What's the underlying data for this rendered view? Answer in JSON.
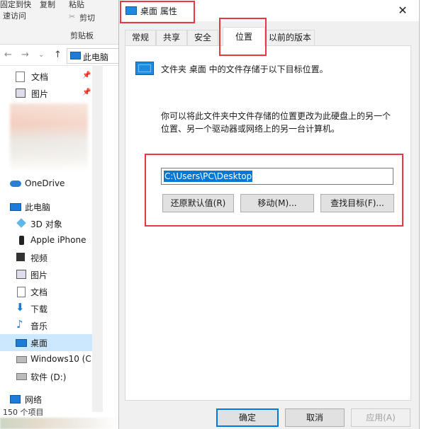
{
  "explorer": {
    "ribbon": {
      "pin_quick_access": "固定到快",
      "quick_access": "速访问",
      "copy": "复制",
      "paste": "粘贴",
      "cut": "剪切",
      "clipboard": "剪贴板"
    },
    "address": {
      "path": "此电脑"
    },
    "nav": {
      "documents": "文档",
      "pictures_pinned": "图片",
      "onedrive": "OneDrive",
      "this_pc": "此电脑",
      "objects3d": "3D 对象",
      "apple_iphone": "Apple iPhone",
      "videos": "视频",
      "pictures": "图片",
      "documents2": "文档",
      "downloads": "下载",
      "music": "音乐",
      "desktop": "桌面",
      "windows10": "Windows10 (C:",
      "software_d": "软件 (D:)",
      "network": "网络"
    },
    "status": "150 个项目"
  },
  "dialog": {
    "title": "桌面 属性",
    "close_glyph": "✕",
    "tabs": [
      "常规",
      "共享",
      "安全",
      "位置",
      "以前的版本"
    ],
    "active_tab": "位置",
    "info": "文件夹 桌面 中的文件存储于以下目标位置。",
    "desc_line1": "你可以将此文件夹中文件存储的位置更改为此硬盘上的另一个",
    "desc_line2": "位置、另一个驱动器或网络上的另一台计算机。",
    "path_value": "C:\\Users\\PC\\Desktop",
    "buttons": {
      "restore_default": "还原默认值(R)",
      "move": "移动(M)...",
      "find_target": "查找目标(F)..."
    },
    "footer": {
      "ok": "确定",
      "cancel": "取消",
      "apply": "应用(A)"
    }
  },
  "colors": {
    "highlight": "#e8383d",
    "selection": "#0078d7",
    "folder_blue": "#1f8ae0"
  }
}
